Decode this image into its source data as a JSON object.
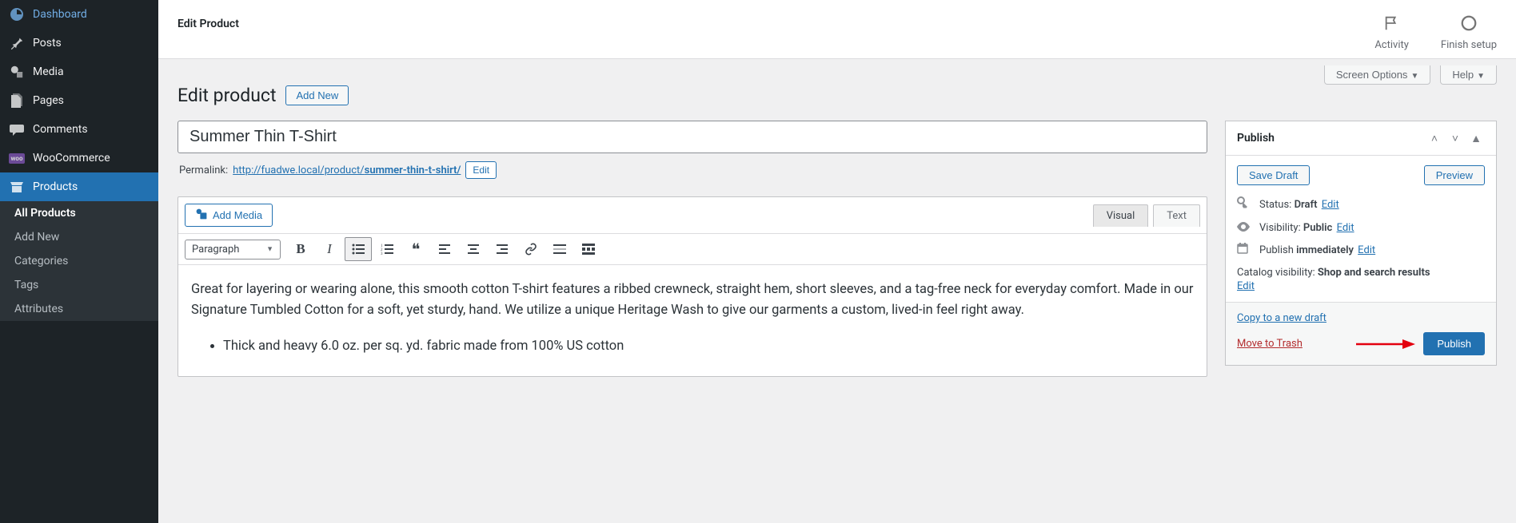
{
  "sidebar": {
    "items": [
      {
        "label": "Dashboard",
        "icon": "dashboard"
      },
      {
        "label": "Posts",
        "icon": "pin"
      },
      {
        "label": "Media",
        "icon": "media"
      },
      {
        "label": "Pages",
        "icon": "pages"
      },
      {
        "label": "Comments",
        "icon": "comments"
      },
      {
        "label": "WooCommerce",
        "icon": "woo"
      },
      {
        "label": "Products",
        "icon": "products",
        "active": true
      }
    ],
    "sub_items": [
      {
        "label": "All Products",
        "active": true
      },
      {
        "label": "Add New"
      },
      {
        "label": "Categories"
      },
      {
        "label": "Tags"
      },
      {
        "label": "Attributes"
      }
    ]
  },
  "topbar": {
    "title": "Edit Product",
    "activity": "Activity",
    "finish_setup": "Finish setup"
  },
  "screen": {
    "options": "Screen Options",
    "help": "Help"
  },
  "page": {
    "heading": "Edit product",
    "add_new": "Add New"
  },
  "product": {
    "title": "Summer Thin T-Shirt",
    "permalink_label": "Permalink:",
    "permalink_base": "http://fuadwe.local/product/",
    "permalink_slug": "summer-thin-t-shirt/",
    "edit": "Edit"
  },
  "editor": {
    "add_media": "Add Media",
    "tabs": {
      "visual": "Visual",
      "text": "Text"
    },
    "format": "Paragraph",
    "body_para": "Great for layering or wearing alone, this smooth cotton T-shirt features a ribbed crewneck, straight hem, short sleeves, and a tag-free neck for everyday comfort. Made in our Signature Tumbled Cotton for a soft, yet sturdy, hand. We utilize a unique Heritage Wash to give our garments a custom, lived-in feel right away.",
    "bullets": [
      "Thick and heavy 6.0 oz. per sq. yd. fabric made from 100% US cotton"
    ]
  },
  "publish": {
    "title": "Publish",
    "save_draft": "Save Draft",
    "preview": "Preview",
    "status_label": "Status:",
    "status_value": "Draft",
    "visibility_label": "Visibility:",
    "visibility_value": "Public",
    "schedule_label": "Publish",
    "schedule_value": "immediately",
    "edit": "Edit",
    "catalog_label": "Catalog visibility:",
    "catalog_value": "Shop and search results",
    "copy_draft": "Copy to a new draft",
    "move_trash": "Move to Trash",
    "publish_btn": "Publish"
  }
}
